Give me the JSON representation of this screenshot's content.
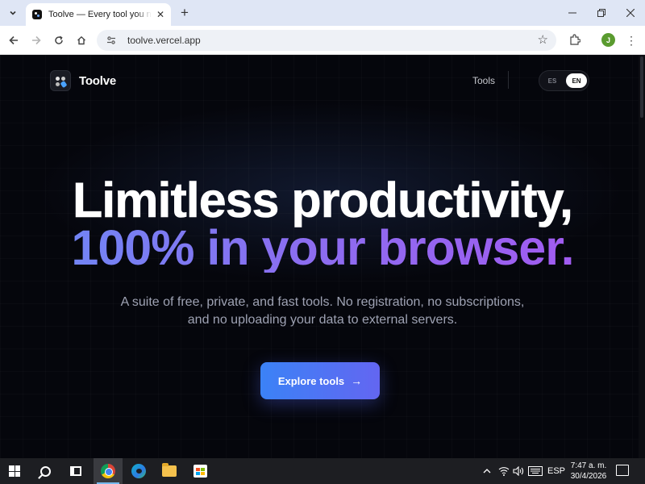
{
  "browser": {
    "tab": {
      "title": "Toolve — Every tool you need, i"
    },
    "url": "toolve.vercel.app",
    "profile_initial": "J"
  },
  "site": {
    "brand": "Toolve",
    "nav": {
      "tools_label": "Tools"
    },
    "lang": {
      "es": "ES",
      "en": "EN",
      "selected": "EN"
    },
    "hero": {
      "line1": "Limitless productivity,",
      "line2": "100% in your browser.",
      "subtitle_line1": "A suite of free, private, and fast tools. No registration, no subscriptions,",
      "subtitle_line2": "and no uploading your data to external servers.",
      "cta_label": "Explore tools"
    },
    "colors": {
      "cta_start": "#3b82f6",
      "cta_end": "#6366f1",
      "gradient_start": "#7086f4",
      "gradient_end": "#a15bf0",
      "background": "#05060c"
    }
  },
  "taskbar": {
    "apps": [
      "start-icon",
      "search-icon",
      "task-view-icon",
      "chrome-icon",
      "edge-icon",
      "file-explorer-icon",
      "store-icon"
    ],
    "language": "ESP",
    "time": "7:47 a. m.",
    "date": "30/4/2026"
  }
}
